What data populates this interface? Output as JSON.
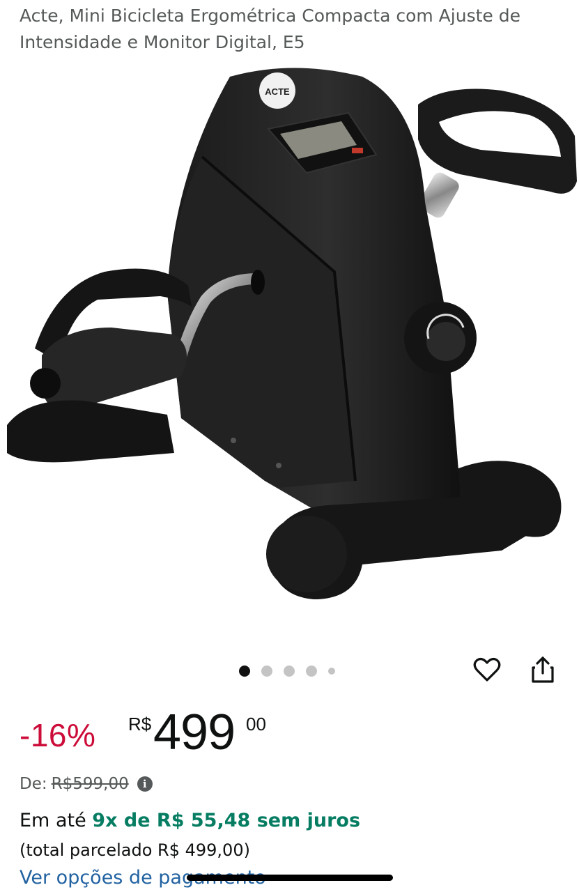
{
  "product": {
    "title": "Acte, Mini Bicicleta Ergométrica Compacta com Ajuste de Intensidade e Monitor Digital, E5",
    "image_brand_label": "ACTE"
  },
  "carousel": {
    "dot_count": 5,
    "active_index": 0
  },
  "actions": {
    "wishlist_icon": "heart-icon",
    "share_icon": "share-icon"
  },
  "price": {
    "discount": "-16%",
    "currency": "R$",
    "whole": "499",
    "fraction": "00",
    "list_label": "De:",
    "list_price": "R$599,00"
  },
  "installments": {
    "prefix": "Em até",
    "highlight": "9x de R$ 55,48 sem juros",
    "total": "(total parcelado R$ 499,00)",
    "link": "Ver opções de pagamento"
  },
  "colors": {
    "discount": "#cc0c39",
    "installment_green": "#067d62",
    "link_blue": "#2162a1"
  }
}
